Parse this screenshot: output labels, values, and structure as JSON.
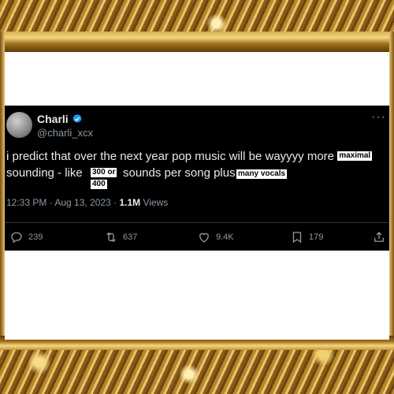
{
  "tweet": {
    "display_name": "Charli",
    "handle": "@charli_xcx",
    "text_line1_prefix": "i predict that over the next year pop music will be wayyyy more",
    "sticker_maximal": "maximal",
    "text_line2_prefix": "sounding - like",
    "sticker_300": "300 or",
    "sticker_400": "400",
    "text_line2_mid": "sounds per song plus",
    "sticker_vocals": "many vocals",
    "meta_time": "12:33 PM · Aug 13, 2023 · ",
    "views_count": "1.1M",
    "views_label": " Views",
    "more": "···"
  },
  "actions": {
    "replies": "239",
    "reposts": "637",
    "likes": "9.4K",
    "bookmarks": "179"
  },
  "colors": {
    "background": "#000000",
    "text": "#e7e9ea",
    "muted": "#8b98a5",
    "verified": "#1d9bf0"
  }
}
